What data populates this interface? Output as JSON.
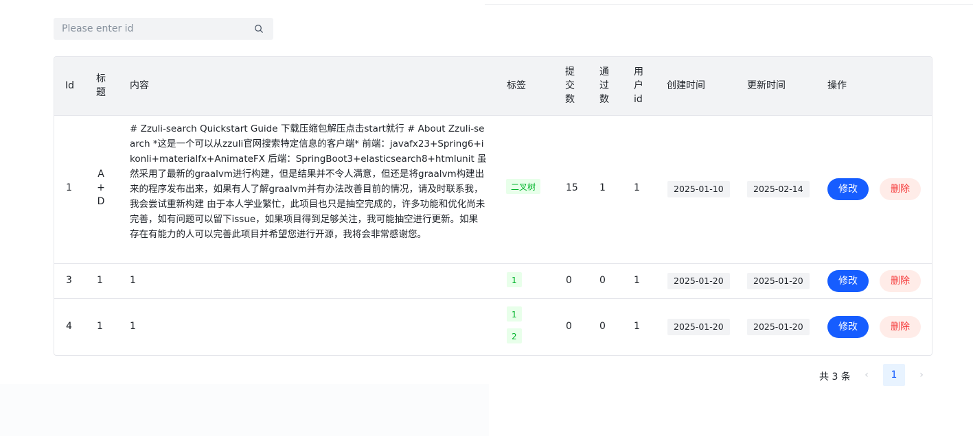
{
  "search": {
    "placeholder": "Please enter id",
    "icon": "search-icon"
  },
  "table": {
    "headers": {
      "id": "Id",
      "title": [
        "标",
        "题"
      ],
      "content": "内容",
      "tags": "标签",
      "submit": [
        "提",
        "交",
        "数"
      ],
      "pass": [
        "通",
        "过",
        "数"
      ],
      "user": [
        "用",
        "户",
        "id"
      ],
      "created": "创建时间",
      "updated": "更新时间",
      "actions": "操作"
    },
    "rows": [
      {
        "id": "1",
        "title": [
          "A",
          "+",
          "D"
        ],
        "content": "# Zzuli-search Quickstart Guide 下载压缩包解压点击start就行 # About Zzuli-search *这是一个可以从zzuli官网搜索特定信息的客户端* 前端：javafx23+Spring6+ikonli+materialfx+AnimateFX 后端：SpringBoot3+elasticsearch8+htmlunit 虽然采用了最新的graalvm进行构建，但是结果并不令人满意，但还是将graalvm构建出来的程序发布出来，如果有人了解graalvm并有办法改善目前的情况，请及时联系我，我会尝试重新构建 由于本人学业繁忙，此项目也只是抽空完成的，许多功能和优化尚未完善，如有问题可以留下issue，如果项目得到足够关注，我可能抽空进行更新。如果存在有能力的人可以完善此项目并希望您进行开源，我将会非常感谢您。",
        "tags": [
          "二叉树"
        ],
        "submit": "15",
        "pass": "1",
        "user": "1",
        "created": "2025-01-10",
        "updated": "2025-02-14",
        "edit": "修改",
        "delete": "删除"
      },
      {
        "id": "3",
        "title": [
          "1"
        ],
        "content": "1",
        "tags": [
          "1"
        ],
        "submit": "0",
        "pass": "0",
        "user": "1",
        "created": "2025-01-20",
        "updated": "2025-01-20",
        "edit": "修改",
        "delete": "删除"
      },
      {
        "id": "4",
        "title": [
          "1"
        ],
        "content": "1",
        "tags": [
          "1",
          "2"
        ],
        "submit": "0",
        "pass": "0",
        "user": "1",
        "created": "2025-01-20",
        "updated": "2025-01-20",
        "edit": "修改",
        "delete": "删除"
      }
    ]
  },
  "pagination": {
    "total_text": "共 3 条",
    "current": "1",
    "prev_icon": "chevron-left-icon",
    "next_icon": "chevron-right-icon"
  },
  "colors": {
    "primary": "#165dff",
    "danger": "#f53f3f",
    "tag_bg": "#e8ffea",
    "tag_text": "#00b42a",
    "header_bg": "#f2f3f5"
  }
}
